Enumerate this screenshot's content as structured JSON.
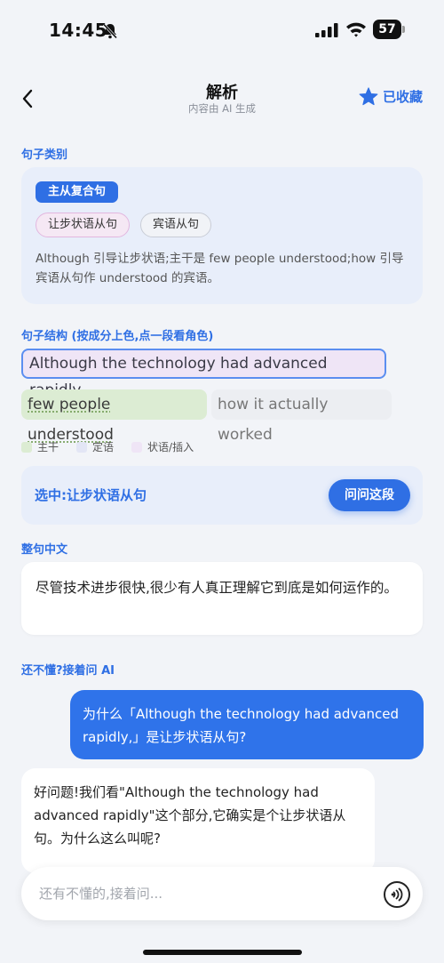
{
  "status_bar": {
    "time": "14:45",
    "battery": "57"
  },
  "nav": {
    "title": "解析",
    "subtitle": "内容由 AI 生成",
    "favorite_label": "已收藏"
  },
  "sentence_type": {
    "heading": "句子类别",
    "main_type": "主从复合句",
    "chips": [
      "让步状语从句",
      "宾语从句"
    ],
    "description": "Although 引导让步状语;主干是 few people understood;how 引导宾语从句作 understood 的宾语。"
  },
  "structure": {
    "heading": "句子结构 (按成分上色,点一段看角色)",
    "segments": {
      "adverbial": "Although the technology had advanced rapidly,",
      "main": "few people understood",
      "object": "how it actually worked"
    },
    "legend": [
      {
        "label": "主干",
        "color": "#dcecd3"
      },
      {
        "label": "定语",
        "color": "#e3e6f5"
      },
      {
        "label": "状语/插入",
        "color": "#efe5f6"
      }
    ],
    "selected_text": "选中:让步状语从句",
    "ask_button": "问问这段"
  },
  "translation": {
    "heading": "整句中文",
    "text": "尽管技术进步很快,很少有人真正理解它到底是如何运作的。"
  },
  "chat": {
    "heading": "还不懂?接着问 AI",
    "user_message": "为什么「Although the technology had advanced rapidly,」是让步状语从句?",
    "ai_message": "好问题!我们看\"Although the technology had advanced rapidly\"这个部分,它确实是个让步状语从句。为什么这么叫呢?",
    "input_placeholder": "还有不懂的,接着问..."
  },
  "colors": {
    "accent": "#2f6fe4",
    "background": "#f2f4f8"
  }
}
